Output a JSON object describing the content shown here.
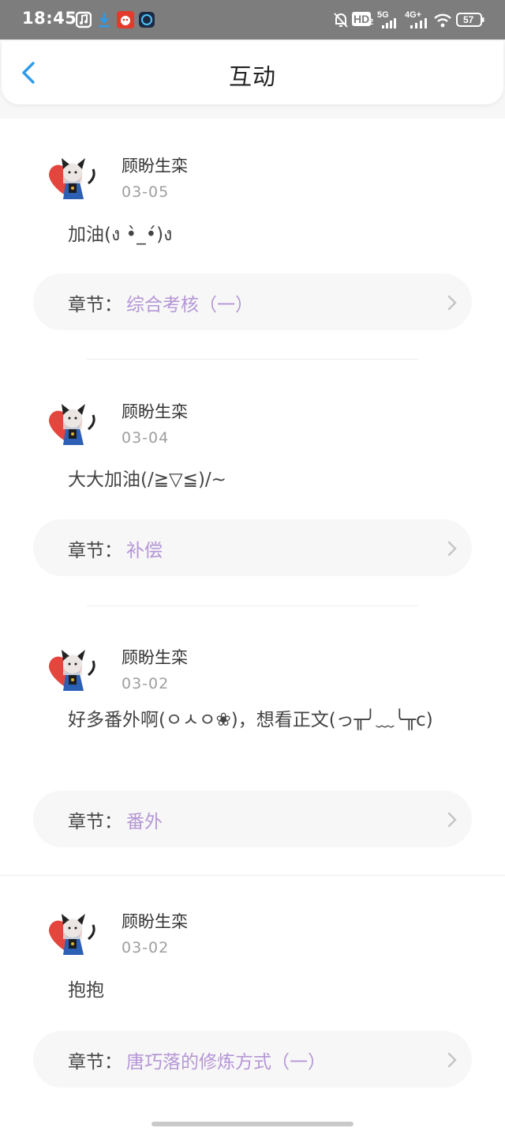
{
  "status_bar": {
    "time": "18:45",
    "icons": [
      "music-icon",
      "download-icon",
      "app-icon",
      "app-icon-2",
      "mute-bell-icon",
      "hd-icon",
      "signal-5g-icon",
      "signal-4g-icon",
      "wifi-icon",
      "battery-icon"
    ],
    "hd_label": "HD",
    "hd_sub": "2",
    "net1_label": "5G",
    "net2_label": "4G+",
    "battery_level": "57"
  },
  "header": {
    "title": "互动"
  },
  "accent_color": "#b596d6",
  "chapter_prefix": "章节：",
  "items": [
    {
      "username": "顾盼生栾",
      "date": "03-05",
      "comment": "加油(ง •̀_•́)ง",
      "chapter": "综合考核（一）"
    },
    {
      "username": "顾盼生栾",
      "date": "03-04",
      "comment": "大大加油(/≧▽≦)/~",
      "chapter": "补偿"
    },
    {
      "username": "顾盼生栾",
      "date": "03-02",
      "comment": "好多番外啊(ㅇㅅㅇ❀)，想看正文(っ╥╯﹏╰╥c)",
      "chapter": "番外"
    },
    {
      "username": "顾盼生栾",
      "date": "03-02",
      "comment": "抱抱",
      "chapter": "唐巧落的修炼方式（一）"
    }
  ]
}
